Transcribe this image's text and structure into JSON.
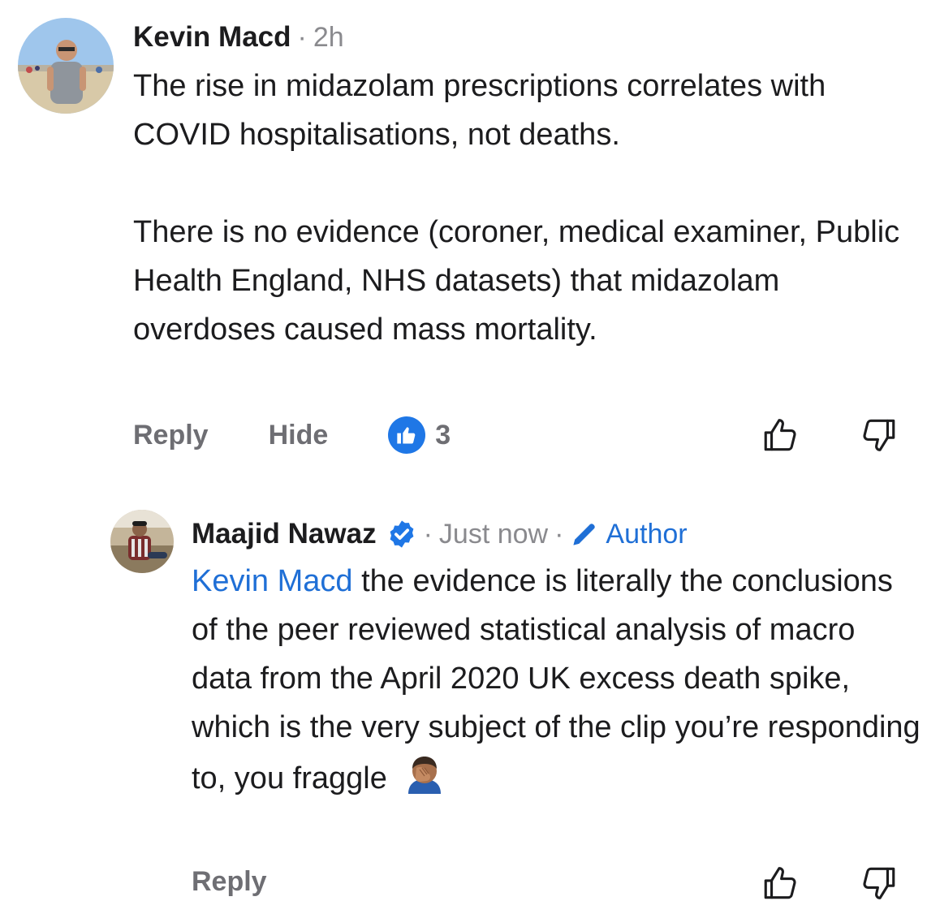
{
  "comments": [
    {
      "author": "Kevin Macd",
      "separator": "·",
      "time": "2h",
      "paragraphs": [
        "The rise in midazolam prescriptions correlates with COVID hospitalisations, not deaths.",
        "There is no evidence (coroner, medical examiner, Public Health England, NHS datasets) that midazolam overdoses caused mass mortality."
      ],
      "actions": {
        "reply_label": "Reply",
        "hide_label": "Hide",
        "like_count": "3"
      },
      "icons": {
        "like_badge": "thumbs-up-badge-icon",
        "upvote": "thumbs-up-outline-icon",
        "downvote": "thumbs-down-outline-icon"
      }
    },
    {
      "author": "Maajid Nawaz",
      "separator": "·",
      "time": "Just now",
      "separator2": "·",
      "author_badge": "Author",
      "mention": "Kevin Macd",
      "text": "the evidence is literally the conclusions of the peer reviewed statistical analysis of macro data from the April 2020 UK excess death spike, which is the very subject of the clip you’re responding to, you fraggle",
      "actions": {
        "reply_label": "Reply"
      },
      "icons": {
        "verified": "verified-badge-icon",
        "author": "pencil-icon",
        "emoji": "face-palm-emoji-icon",
        "upvote": "thumbs-up-outline-icon",
        "downvote": "thumbs-down-outline-icon"
      }
    }
  ],
  "colors": {
    "accent": "#1f6fd6",
    "like_badge": "#1f77e6",
    "secondary_text": "#8a8a8e",
    "action_text": "#6e6e73"
  }
}
